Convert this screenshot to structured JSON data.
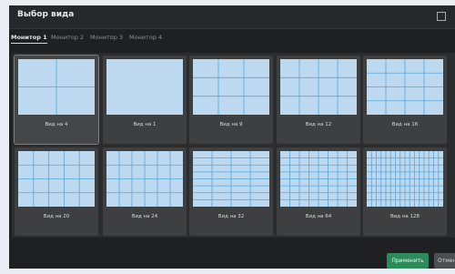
{
  "dialog": {
    "title": "Выбор вида"
  },
  "tabs": [
    {
      "label": "Монитор 1",
      "active": true
    },
    {
      "label": "Монитор 2",
      "active": false
    },
    {
      "label": "Монитор 3",
      "active": false
    },
    {
      "label": "Монитор 4",
      "active": false
    }
  ],
  "views": [
    {
      "label": "Вид на 4",
      "cols": 2,
      "rows": 2,
      "selected": true
    },
    {
      "label": "Вид на 1",
      "cols": 1,
      "rows": 1
    },
    {
      "label": "Вид на 9",
      "cols": 3,
      "rows": 3
    },
    {
      "label": "Вид на 12",
      "cols": 4,
      "rows": 3
    },
    {
      "label": "Вид на 16",
      "cols": 4,
      "rows": 4
    },
    {
      "label": "Вид на 20",
      "cols": 5,
      "rows": 4
    },
    {
      "label": "Вид на 24",
      "cols": 6,
      "rows": 4
    },
    {
      "label": "Вид на 32",
      "cols": 4,
      "rows": 8
    },
    {
      "label": "Вид на 64",
      "cols": 8,
      "rows": 8
    },
    {
      "label": "Вид на 128",
      "cols": 16,
      "rows": 8
    }
  ],
  "footer": {
    "apply_label": "Применить",
    "cancel_label": "Отмена"
  },
  "colors": {
    "preview_fill": "#bcd9ef",
    "grid_line": "#5aa4d8",
    "accent": "#2d8a5a"
  }
}
